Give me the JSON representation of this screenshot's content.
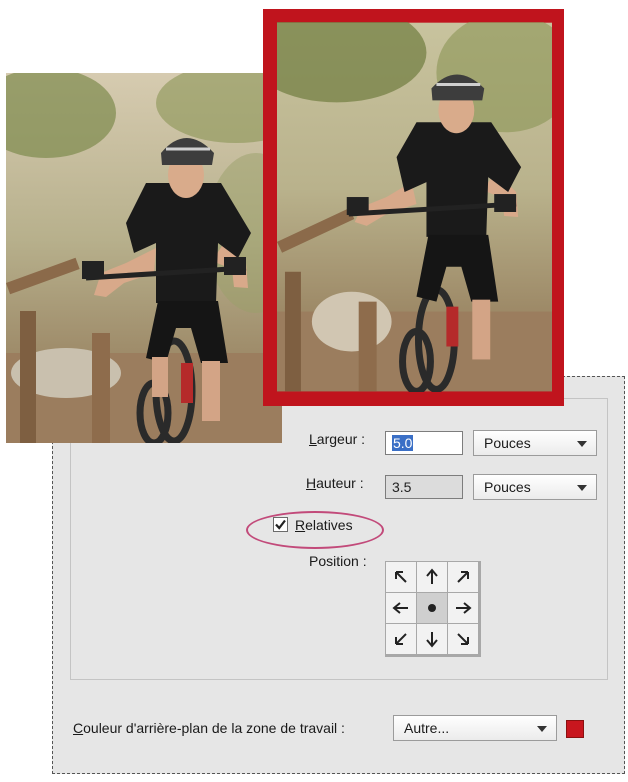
{
  "dialog": {
    "width_label": "Largeur :",
    "width_value": "5.0",
    "width_unit": "Pouces",
    "height_label": "Hauteur :",
    "height_value": "3.5",
    "height_unit": "Pouces",
    "relative_label": "Relatives",
    "relative_checked": true,
    "position_label": "Position :",
    "background_label": "Couleur d'arrière-plan de la zone de travail :",
    "background_value": "Autre...",
    "background_color": "#c8161e"
  },
  "colors": {
    "canvas_border": "#c0141d",
    "callout": "#c24a7a",
    "selection": "#3a6fc6"
  },
  "icons": {
    "anchor": [
      "arrow-up-left-icon",
      "arrow-up-icon",
      "arrow-up-right-icon",
      "arrow-left-icon",
      "anchor-center-icon",
      "arrow-right-icon",
      "arrow-down-left-icon",
      "arrow-down-icon",
      "arrow-down-right-icon"
    ]
  }
}
